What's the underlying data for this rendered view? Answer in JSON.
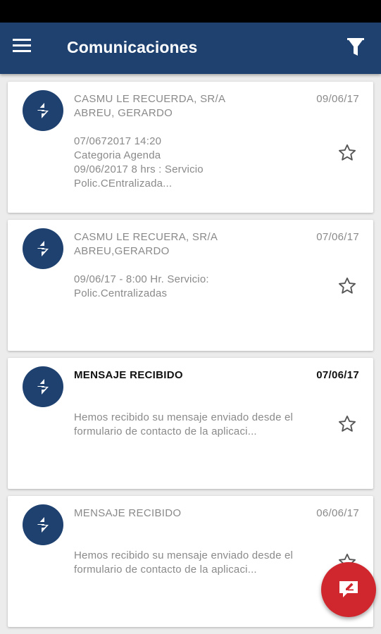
{
  "app": {
    "title": "Comunicaciones"
  },
  "colors": {
    "appbar": "#1f4170",
    "fab": "#d0262d",
    "avatar": "#1f4170"
  },
  "icons": {
    "menu": "menu-icon",
    "filter": "filter-icon",
    "avatar": "logo-icon",
    "star": "star-outline-icon",
    "compose": "compose-message-icon"
  },
  "messages": [
    {
      "sender_line1": "CASMU LE RECUERDA, SR/A",
      "sender_line2": "ABREU, GERARDO",
      "date": "09/06/17",
      "body": [
        "07/0672017 14:20",
        "Categoria Agenda",
        "09/06/2017 8 hrs : Servicio",
        "Polic.CEntralizada..."
      ],
      "unread": false
    },
    {
      "sender_line1": "CASMU LE RECUERA, SR/A",
      "sender_line2": "ABREU,GERARDO",
      "date": "07/06/17",
      "body": [
        "09/06/17 -  8:00 Hr. Servicio:",
        "Polic.Centralizadas"
      ],
      "unread": false
    },
    {
      "sender_line1": "MENSAJE RECIBIDO",
      "sender_line2": "",
      "date": "07/06/17",
      "body": [
        "Hemos recibido su mensaje enviado desde el",
        "formulario de contacto de la aplicaci..."
      ],
      "unread": true
    },
    {
      "sender_line1": "MENSAJE RECIBIDO",
      "sender_line2": "",
      "date": "06/06/17",
      "body": [
        "Hemos recibido su mensaje enviado desde el",
        "formulario de contacto de la aplicaci..."
      ],
      "unread": false
    }
  ]
}
